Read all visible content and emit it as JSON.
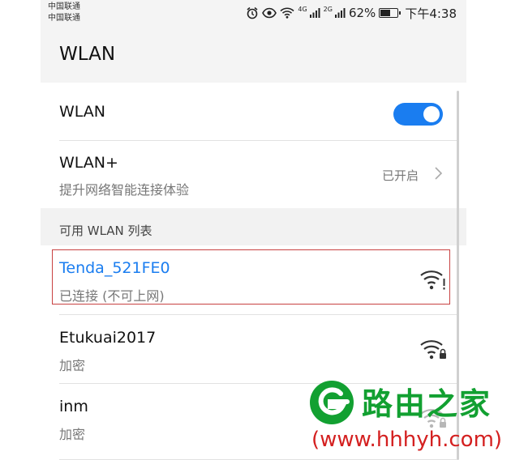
{
  "status_bar": {
    "carrier_1": "中国联通",
    "carrier_2": "中国联通",
    "icons": [
      "alarm-icon",
      "eye-icon",
      "wifi-icon",
      "signal-4g-icon",
      "signal-2g-icon",
      "battery-icon"
    ],
    "signal_1_label": "4G",
    "signal_2_label": "2G",
    "battery": "62%",
    "battery_level": 0.62,
    "time": "下午4:38"
  },
  "title_bar": {
    "title": "WLAN"
  },
  "settings": {
    "wlan_label": "WLAN",
    "wlan_on": true,
    "wlan_plus_label": "WLAN+",
    "wlan_plus_desc": "提升网络智能连接体验",
    "wlan_plus_status": "已开启"
  },
  "section": {
    "label": "可用 WLAN 列表"
  },
  "networks": [
    {
      "ssid": "Tenda_521FE0",
      "status": "已连接 (不可上网)",
      "icon": "wifi-warning-icon",
      "color": "#1a7df0"
    },
    {
      "ssid": "Etukuai2017",
      "status": "加密",
      "icon": "wifi-lock-icon"
    },
    {
      "ssid": "inm",
      "status": "加密",
      "icon": "wifi-lock-icon"
    }
  ],
  "watermark": {
    "name": "路由之家",
    "url": "(www.hhhyh.com)",
    "colors": {
      "green": "#12a031",
      "red": "#d42020"
    }
  },
  "colors": {
    "accent": "#1a7df0"
  }
}
